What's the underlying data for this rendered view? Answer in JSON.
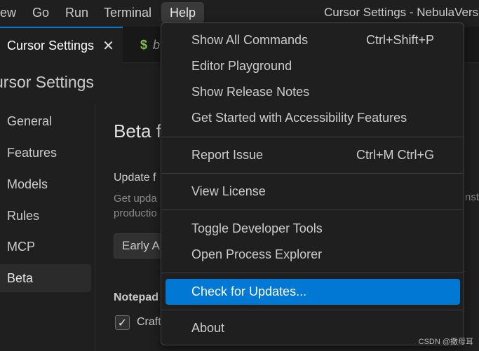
{
  "menubar": {
    "items": [
      "ew",
      "Go",
      "Run",
      "Terminal",
      "Help"
    ],
    "window_title": "Cursor Settings - NebulaVerse"
  },
  "tabs": {
    "active_label": "Cursor Settings",
    "close_glyph": "✕",
    "inactive_icon": "$",
    "inactive_label": "b"
  },
  "settings": {
    "title": "ursor Settings",
    "nav": [
      "General",
      "Features",
      "Models",
      "Rules",
      "MCP",
      "Beta"
    ],
    "selected_nav": "Beta",
    "main": {
      "heading": "Beta f",
      "update_label": "Update f",
      "update_desc_line1": "Get upda",
      "update_desc_line2": "productio",
      "update_desc_right": "nst",
      "dropdown_value": "Early A",
      "notepad_label": "Notepad",
      "checkbox_label": "Craft",
      "checkbox_checked": true
    }
  },
  "help_menu": {
    "items": [
      {
        "label": "Show All Commands",
        "shortcut": "Ctrl+Shift+P"
      },
      {
        "label": "Editor Playground",
        "shortcut": ""
      },
      {
        "label": "Show Release Notes",
        "shortcut": ""
      },
      {
        "label": "Get Started with Accessibility Features",
        "shortcut": ""
      },
      {
        "label": "Report Issue",
        "shortcut": "Ctrl+M Ctrl+G"
      },
      {
        "label": "View License",
        "shortcut": ""
      },
      {
        "label": "Toggle Developer Tools",
        "shortcut": ""
      },
      {
        "label": "Open Process Explorer",
        "shortcut": ""
      },
      {
        "label": "Check for Updates...",
        "shortcut": ""
      },
      {
        "label": "About",
        "shortcut": ""
      }
    ],
    "highlighted": "Check for Updates..."
  },
  "watermark": "CSDN @撒母耳",
  "colors": {
    "accent": "#0078d4",
    "background": "#1f1f1f",
    "menu_border": "#454545"
  }
}
